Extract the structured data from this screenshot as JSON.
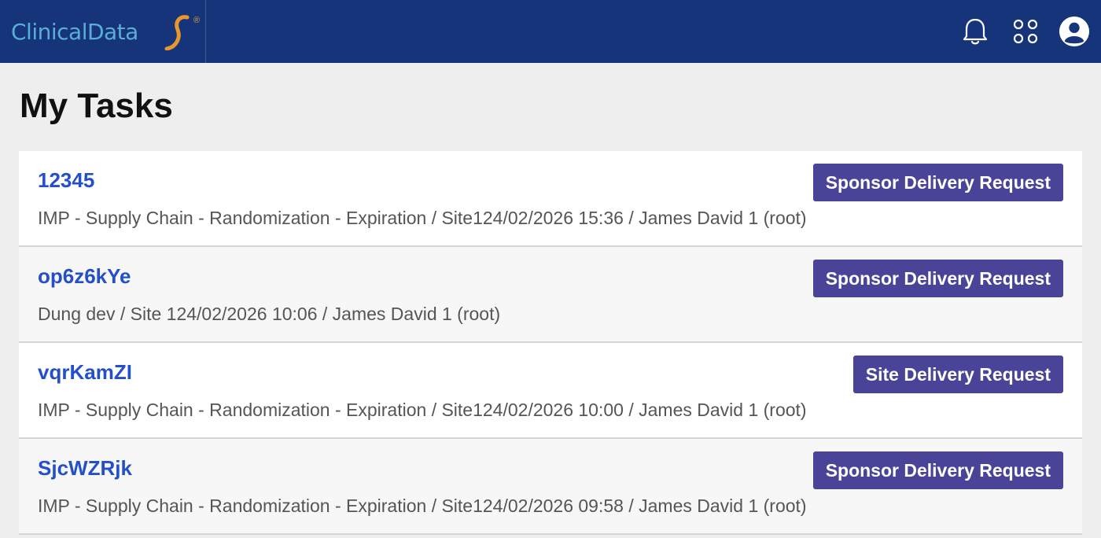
{
  "header": {
    "logo_text": "ClinicalData",
    "logo_mark": "®",
    "icons": [
      "bell-icon",
      "apps-grid-icon",
      "user-avatar-icon"
    ],
    "colors": {
      "bar": "#15347a",
      "logo_text": "#5aaed6",
      "logo_swoosh": "#e8962e"
    }
  },
  "page": {
    "title": "My Tasks"
  },
  "tasks": [
    {
      "id": "12345",
      "meta": "IMP - Supply Chain - Randomization - Expiration / Site124/02/2026 15:36 / James David 1 (root)",
      "type": "Sponsor Delivery Request"
    },
    {
      "id": "op6z6kYe",
      "meta": "Dung dev / Site 124/02/2026 10:06 / James David 1 (root)",
      "type": "Sponsor Delivery Request"
    },
    {
      "id": "vqrKamZI",
      "meta": "IMP - Supply Chain - Randomization - Expiration / Site124/02/2026 10:00 / James David 1 (root)",
      "type": "Site Delivery Request"
    },
    {
      "id": "SjcWZRjk",
      "meta": "IMP - Supply Chain - Randomization - Expiration / Site124/02/2026 09:58 / James David 1 (root)",
      "type": "Sponsor Delivery Request"
    }
  ],
  "colors": {
    "task_link": "#2350c8",
    "badge": "#4a4499"
  }
}
